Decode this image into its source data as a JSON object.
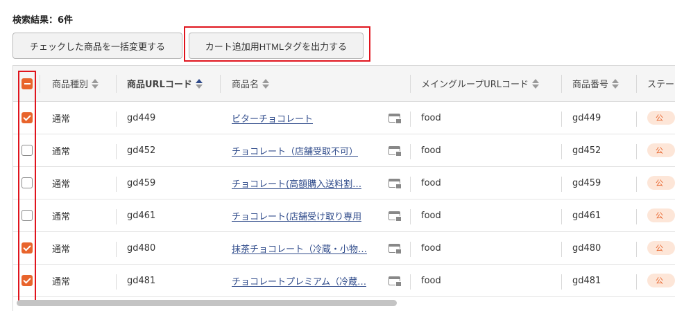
{
  "search": {
    "result_text": "検索結果：6件"
  },
  "toolbar": {
    "bulk_change_label": "チェックした商品を一括変更する",
    "cart_tag_label": "カート追加用HTMLタグを出力する"
  },
  "table": {
    "headers": {
      "type": "商品種別",
      "url_code": "商品URLコード",
      "name": "商品名",
      "group_code": "メイングループURLコード",
      "number": "商品番号",
      "status": "ステー"
    },
    "rows": [
      {
        "checked": true,
        "type": "通常",
        "url_code": "gd449",
        "name": "ビターチョコレート",
        "group": "food",
        "number": "gd449",
        "status": "公"
      },
      {
        "checked": false,
        "type": "通常",
        "url_code": "gd452",
        "name": "チョコレート（店舗受取不可）",
        "group": "food",
        "number": "gd452",
        "status": "公"
      },
      {
        "checked": false,
        "type": "通常",
        "url_code": "gd459",
        "name": "チョコレート(高額購入送料割…",
        "group": "food",
        "number": "gd459",
        "status": "公"
      },
      {
        "checked": false,
        "type": "通常",
        "url_code": "gd461",
        "name": "チョコレート(店舗受け取り専用",
        "group": "food",
        "number": "gd461",
        "status": "公"
      },
      {
        "checked": true,
        "type": "通常",
        "url_code": "gd480",
        "name": "抹茶チョコレート（冷蔵・小物…",
        "group": "food",
        "number": "gd480",
        "status": "公"
      },
      {
        "checked": true,
        "type": "通常",
        "url_code": "gd481",
        "name": "チョコレートプレミアム（冷蔵…",
        "group": "food",
        "number": "gd481",
        "status": "公"
      }
    ]
  },
  "colors": {
    "accent": "#e8642c",
    "link": "#2e4a8a",
    "highlight": "#e0141d"
  },
  "icons": {
    "name_preview": "preview-window-icon",
    "sort": "sort-arrows-icon"
  },
  "scroll": {
    "horizontal_position": 0.0
  }
}
